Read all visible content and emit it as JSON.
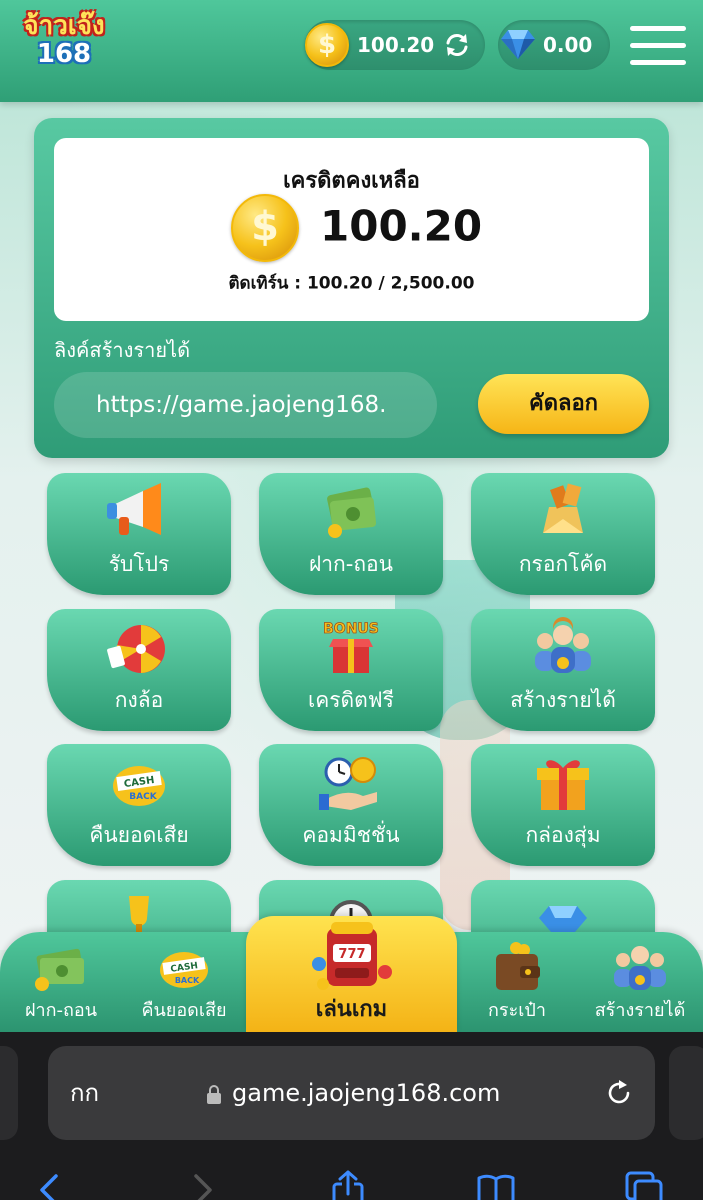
{
  "header": {
    "logo_line1": "จ้าวเจ๊ง",
    "logo_line2": "168",
    "credit_value": "100.20",
    "gem_value": "0.00",
    "coin_symbol": "$"
  },
  "credit_panel": {
    "title": "เครดิตคงเหลือ",
    "amount": "100.20",
    "turnover": "ติดเทิร์น : 100.20 / 2,500.00",
    "link_label": "ลิงค์สร้างรายได้",
    "link_value": "https://game.jaojeng168.",
    "copy_label": "คัดลอก"
  },
  "menu": [
    {
      "label": "รับโปร",
      "icon": "megaphone-icon"
    },
    {
      "label": "ฝาก-ถอน",
      "icon": "money-stack-icon"
    },
    {
      "label": "กรอกโค้ด",
      "icon": "coupon-icon"
    },
    {
      "label": "กงล้อ",
      "icon": "wheel-icon"
    },
    {
      "label": "เครดิตฟรี",
      "icon": "bonus-box-icon"
    },
    {
      "label": "สร้างรายได้",
      "icon": "team-icon"
    },
    {
      "label": "คืนยอดเสีย",
      "icon": "cashback-icon"
    },
    {
      "label": "คอมมิชชั่น",
      "icon": "commission-icon"
    },
    {
      "label": "กล่องสุ่ม",
      "icon": "gift-box-icon"
    },
    {
      "label": "",
      "icon": "trophy-icon"
    },
    {
      "label": "",
      "icon": "clock-icon"
    },
    {
      "label": "",
      "icon": "diamond-icon"
    }
  ],
  "bottom_nav": [
    {
      "label": "ฝาก-ถอน",
      "icon": "money-stack-icon"
    },
    {
      "label": "คืนยอดเสีย",
      "icon": "cashback-icon"
    },
    {
      "label": "เล่นเกม",
      "icon": "slot-machine-icon"
    },
    {
      "label": "กระเป๋า",
      "icon": "wallet-icon"
    },
    {
      "label": "สร้างรายได้",
      "icon": "team-icon"
    }
  ],
  "browser": {
    "text_size_label": "กก",
    "url": "game.jaojeng168.com"
  },
  "colors": {
    "brand_green": "#3fb48a",
    "accent_yellow": "#f6c21b"
  }
}
